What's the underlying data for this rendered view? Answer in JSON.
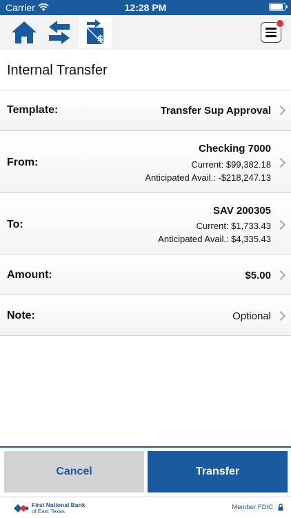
{
  "status_bar": {
    "carrier": "Carrier",
    "time": "12:28 PM"
  },
  "nav": {
    "icons": [
      "home-icon",
      "transfer-arrows-icon",
      "transfer-money-icon"
    ],
    "active": "transfer-money-icon"
  },
  "page": {
    "title": "Internal Transfer"
  },
  "form": {
    "template": {
      "label": "Template:",
      "value": "Transfer Sup Approval"
    },
    "from": {
      "label": "From:",
      "account": "Checking 7000",
      "current": "Current:  $99,382.18",
      "anticipated": "Anticipated Avail.:  -$218,247.13"
    },
    "to": {
      "label": "To:",
      "account": "SAV 200305",
      "current": "Current:  $1,733.43",
      "anticipated": "Anticipated Avail.:  $4,335.43"
    },
    "amount": {
      "label": "Amount:",
      "value": "$5.00"
    },
    "note": {
      "label": "Note:",
      "placeholder": "Optional"
    }
  },
  "actions": {
    "cancel": "Cancel",
    "transfer": "Transfer"
  },
  "footer": {
    "bank_line1": "First National Bank",
    "bank_line2": "of East Texas",
    "fdic": "Member FDIC"
  },
  "colors": {
    "brand": "#1a5ba0",
    "cancel_bg": "#d2d2d2",
    "badge": "#e0332f"
  }
}
